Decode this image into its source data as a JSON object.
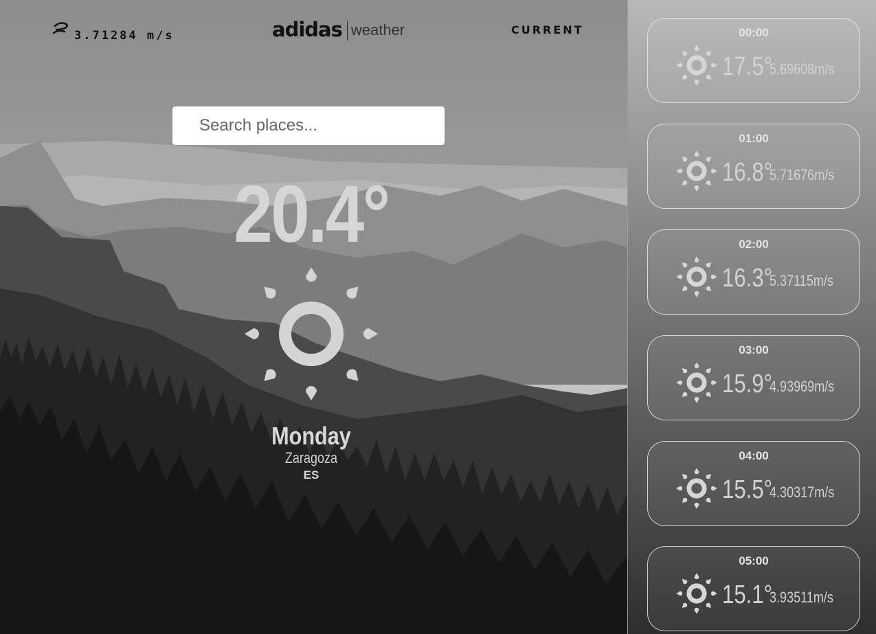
{
  "header": {
    "wind_speed": "3.71284 m/s",
    "brand_name": "adidas",
    "brand_sub": "weather",
    "current_tab": "CURRENT"
  },
  "search": {
    "placeholder": "Search places..."
  },
  "current": {
    "temperature": "20.4°",
    "day": "Monday",
    "city": "Zaragoza",
    "country": "ES",
    "icon": "sun-icon"
  },
  "forecast": [
    {
      "time": "00:00",
      "temp": "17.5°",
      "wind": "5.69608m/s",
      "icon": "sun-icon"
    },
    {
      "time": "01:00",
      "temp": "16.8°",
      "wind": "5.71676m/s",
      "icon": "sun-icon"
    },
    {
      "time": "02:00",
      "temp": "16.3°",
      "wind": "5.37115m/s",
      "icon": "sun-icon"
    },
    {
      "time": "03:00",
      "temp": "15.9°",
      "wind": "4.93969m/s",
      "icon": "sun-icon"
    },
    {
      "time": "04:00",
      "temp": "15.5°",
      "wind": "4.30317m/s",
      "icon": "sun-icon"
    },
    {
      "time": "05:00",
      "temp": "15.1°",
      "wind": "3.93511m/s",
      "icon": "sun-icon"
    }
  ],
  "colors": {
    "sun_icon": "#d4d4d4",
    "text_light": "#d6d6d6",
    "header_text": "#111111",
    "card_border": "#ebebeb"
  }
}
